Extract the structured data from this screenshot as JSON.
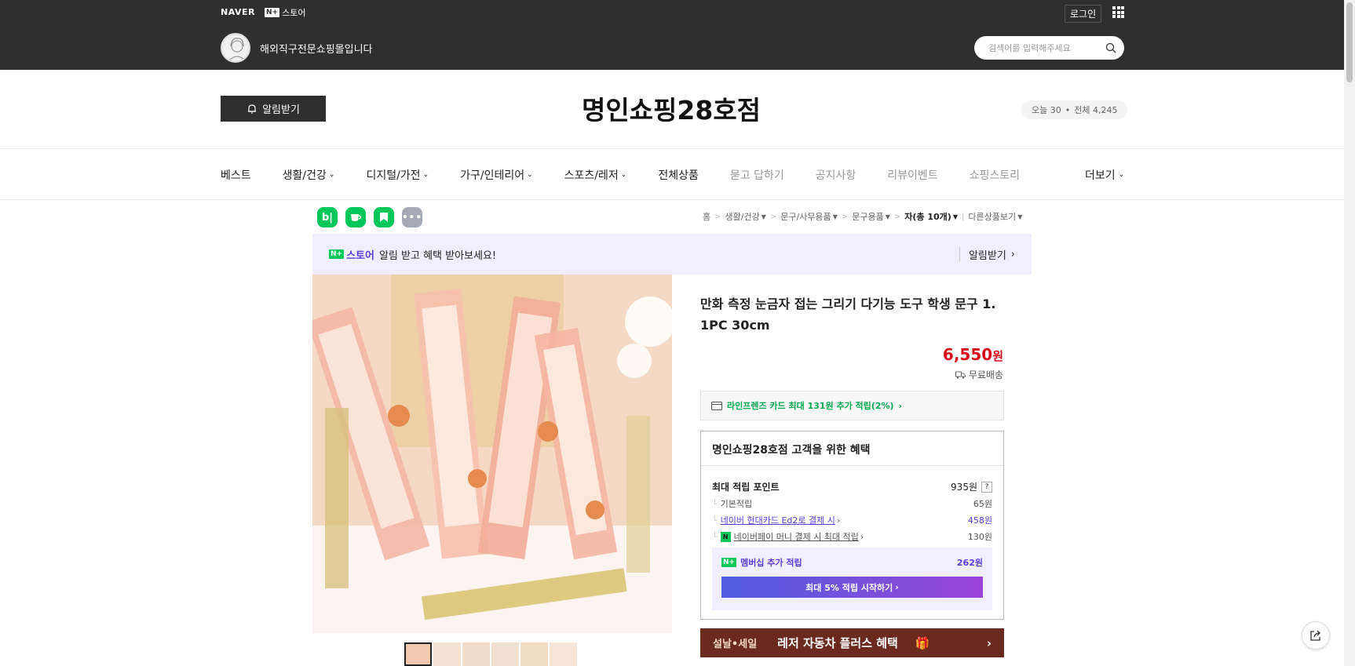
{
  "topbar": {
    "naver_logo": "NAVER",
    "nstore_badge": "N+",
    "nstore_text": "스토어",
    "login": "로그인",
    "store_description": "해외직구전문쇼핑몰입니다",
    "search_placeholder": "검색어를 입력해주세요"
  },
  "store": {
    "alarm_button": "알림받기",
    "title": "명인쇼핑28호점",
    "visits_today": "오늘 30",
    "visits_total": "전체 4,245"
  },
  "nav": {
    "items": [
      {
        "label": "베스트"
      },
      {
        "label": "생활/건강"
      },
      {
        "label": "디지털/가전"
      },
      {
        "label": "가구/인테리어"
      },
      {
        "label": "스포츠/레저"
      },
      {
        "label": "전체상품"
      },
      {
        "label": "묻고 답하기"
      },
      {
        "label": "공지사항"
      },
      {
        "label": "리뷰이벤트"
      },
      {
        "label": "쇼핑스토리"
      }
    ],
    "more": "더보기"
  },
  "social": {
    "blog_label": "b|"
  },
  "breadcrumb": {
    "items": [
      "홈",
      "생활/건강",
      "문구/사무용품",
      "문구용품",
      "자(총 10개)",
      "다른상품보기"
    ]
  },
  "banner": {
    "badge": "N+",
    "brand": "스토어",
    "text": "알림 받고 혜택 받아보세요!",
    "action": "알림받기"
  },
  "product": {
    "title": "만화 측정 눈금자 접는 그리기 다기능 도구 학생 문구 1. 1PC 30cm",
    "price": "6,550",
    "currency": "원",
    "shipping": "무료배송",
    "card_offer": "라인프렌즈 카드 최대 131원 추가 적립(2%)"
  },
  "benefit": {
    "title": "명인쇼핑28호점 고객을 위한 혜택",
    "max_point_label": "최대 적립 포인트",
    "max_point_value": "935원",
    "question_mark": "?",
    "rows": [
      {
        "label": "기본적립",
        "value": "65원"
      },
      {
        "label": "네이버 현대카드 Ed2로 결제 시",
        "value": "458원"
      },
      {
        "label": "네이버페이 머니 결제 시 최대 적립",
        "value": "130원"
      }
    ],
    "membership_badge": "N+",
    "membership_label": "멤버십 추가 적립",
    "membership_value": "262원",
    "membership_button": "최대 5% 적립 시작하기"
  },
  "promo": {
    "small": "설날•세일",
    "text": "레저 자동차 플러스 혜택"
  },
  "colors": {
    "topbar": "#2f2f2f",
    "price": "#d80c18",
    "naver_green": "#03c75a",
    "nplus_purple": "#5b3bd8"
  }
}
